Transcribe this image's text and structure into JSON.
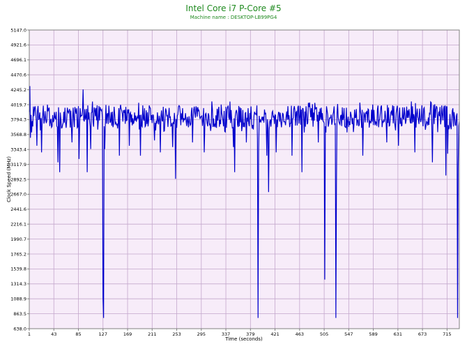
{
  "chart_data": {
    "type": "line",
    "title": "Intel Core i7 P-Core #5",
    "subtitle": "Machine name : DESKTOP-LB99PG4",
    "xlabel": "Time (seconds)",
    "ylabel": "Clock Speed (MHz)",
    "xlim": [
      1,
      736
    ],
    "ylim": [
      638.0,
      5147.0
    ],
    "x_ticks": [
      "1",
      "43",
      "85",
      "127",
      "169",
      "211",
      "253",
      "295",
      "337",
      "379",
      "421",
      "463",
      "505",
      "547",
      "589",
      "631",
      "673",
      "715"
    ],
    "y_ticks": [
      "5147.0",
      "4921.6",
      "4696.1",
      "4470.6",
      "4245.2",
      "4019.7",
      "3794.3",
      "3568.8",
      "3343.4",
      "3117.9",
      "2892.5",
      "2667.0",
      "2441.6",
      "2216.1",
      "1990.7",
      "1765.2",
      "1539.8",
      "1314.3",
      "1088.9",
      "863.5",
      "638.0"
    ],
    "grid": true,
    "background_color": "#f7ecf9",
    "grid_color": "#c4a7cc",
    "line_color": "#0000cc",
    "title_color": "#1f8a1f",
    "series": [
      {
        "values": []
      }
    ]
  }
}
